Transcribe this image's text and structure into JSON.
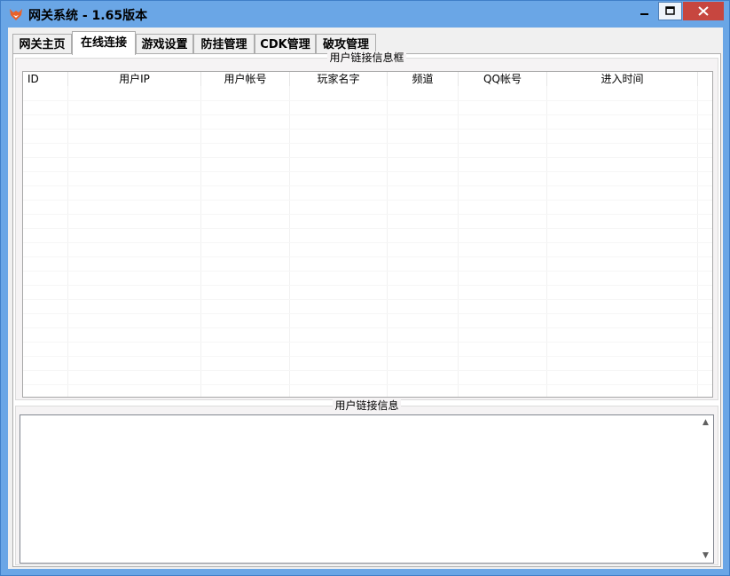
{
  "window": {
    "title": "网关系统 - 1.65版本",
    "colors": {
      "frame": "#6aa6e6",
      "close": "#c7463f"
    }
  },
  "tabs": [
    {
      "label": "网关主页",
      "active": false
    },
    {
      "label": "在线连接",
      "active": true
    },
    {
      "label": "游戏设置",
      "active": false
    },
    {
      "label": "防挂管理",
      "active": false
    },
    {
      "label": "CDK管理",
      "active": false
    },
    {
      "label": "破攻管理",
      "active": false
    }
  ],
  "connections_group": {
    "title": "用户链接信息框",
    "columns": [
      "ID",
      "用户IP",
      "用户帐号",
      "玩家名字",
      "频道",
      "QQ帐号",
      "进入时间"
    ],
    "rows": []
  },
  "log_group": {
    "title": "用户链接信息",
    "content": ""
  },
  "icons": {
    "app": "fox-icon",
    "minimize": "minimize-icon",
    "maximize": "maximize-icon",
    "close": "close-icon",
    "scroll_up": "chevron-up-icon",
    "scroll_down": "chevron-down-icon"
  }
}
